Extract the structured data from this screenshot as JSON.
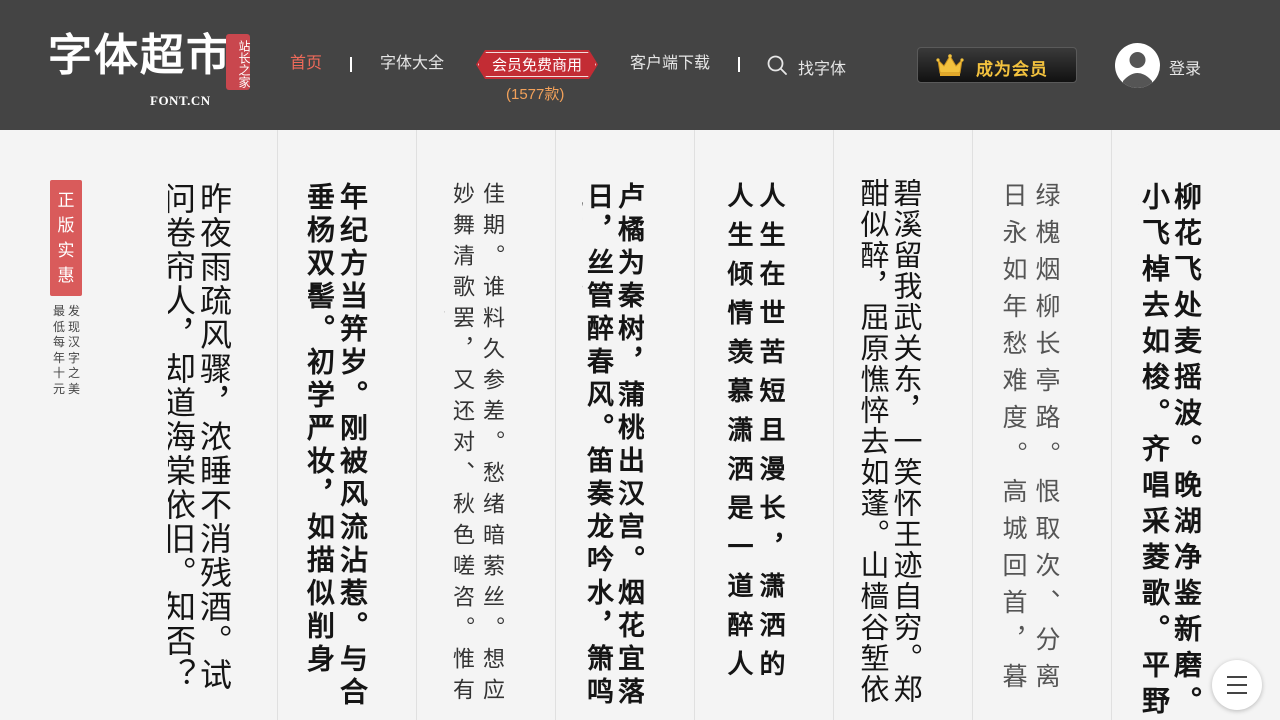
{
  "header": {
    "logo": {
      "main": "字体超市",
      "seal": "站长之家",
      "sub": "FONT.CN"
    },
    "nav": {
      "home": "首页",
      "fonts": "字体大全",
      "member_free": "会员免费商用",
      "member_count": "(1577款)",
      "client_download": "客户端下载",
      "find_font": "找字体"
    },
    "vip_button": "成为会员",
    "login": "登录",
    "colors": {
      "header_bg": "#444444",
      "active": "#ef6a5a",
      "badge": "#c32c34",
      "count": "#f2a15a",
      "vip_gold": "#f3c23e"
    }
  },
  "promo": {
    "tag": "正版实惠",
    "line1": "发现汉字之美",
    "line2": "最低每年十元"
  },
  "fonts": [
    {
      "name": "",
      "sample": "昨夜雨疏风骤，浓睡不消残酒。试问卷帘人，却道海棠依旧。知否？知否？"
    },
    {
      "name": "",
      "sample": "年纪方当笄岁。刚被风流沾惹。与合垂杨双髻。初学严妆，如描似削身材，怯雨羞云情意。满搦宫腰纤细。"
    },
    {
      "name": "",
      "sample": "佳期。谁料久参差。愁绪暗萦丝。想应妙舞清歌罢，又还对、秋色嗟咨。惟有画楼，当时"
    },
    {
      "name": "",
      "sample": "卢橘为秦树，蒲桃出汉宫。烟花宜落日，丝管醉春风。笛奏龙吟水，箫鸣凤下空。"
    },
    {
      "name": "",
      "sample": "人生在世苦短且漫长，潇洒的人生倾情羡慕潇洒是一道醉人的风景"
    },
    {
      "name": "",
      "sample": "碧溪留我武关东，一笑怀王迹自穷。郑酣似醉，屈原憔悴去如蓬。山樯谷堑依"
    },
    {
      "name": "",
      "sample": "绿槐烟柳长亭路。恨取次、分离日永如年愁难度。高城回首，暮"
    },
    {
      "name": "",
      "sample": "柳花飞处麦摇波。晚湖净鉴新磨。小飞棹去如梭。齐唱采菱歌。平野水"
    }
  ],
  "menu_icon": "menu-icon"
}
